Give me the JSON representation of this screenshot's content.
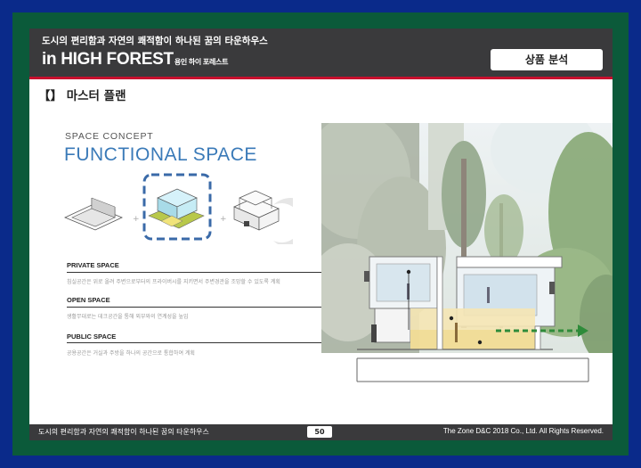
{
  "header": {
    "tagline": "도시의 편리함과 자연의 쾌적함이 하나된 꿈의 타운하우스",
    "title": "in HIGH FOREST",
    "title_sub": "용인 하이 포레스트",
    "badge": "상품 분석"
  },
  "section": {
    "title": "【】 마스터 플랜"
  },
  "diagram": {
    "concept_label": "SPACE CONCEPT",
    "heading": "FUNCTIONAL SPACE",
    "spaces": [
      {
        "label": "PRIVATE SPACE",
        "desc": "침실공간은 위로 올려 주변으로부터의 프라이버시를 지키면서 주변경관을 조망할 수 있도록 계획"
      },
      {
        "label": "OPEN SPACE",
        "desc": "생활무대로는 데크공간을 통해 외부와의 연계성을 높임"
      },
      {
        "label": "PUBLIC SPACE",
        "desc": "공용공간은 거실과 주방을 하나의 공간으로 통합하여 계획"
      }
    ],
    "colors": {
      "accent_blue": "#3a7ab8",
      "highlight_green": "#2e8b3a"
    }
  },
  "footer": {
    "left": "도시의 편리함과 자연의 쾌적함이 하나된 꿈의 타운하우스",
    "page": "50",
    "right": "The Zone D&C 2018 Co., Ltd. All Rights Reserved."
  }
}
